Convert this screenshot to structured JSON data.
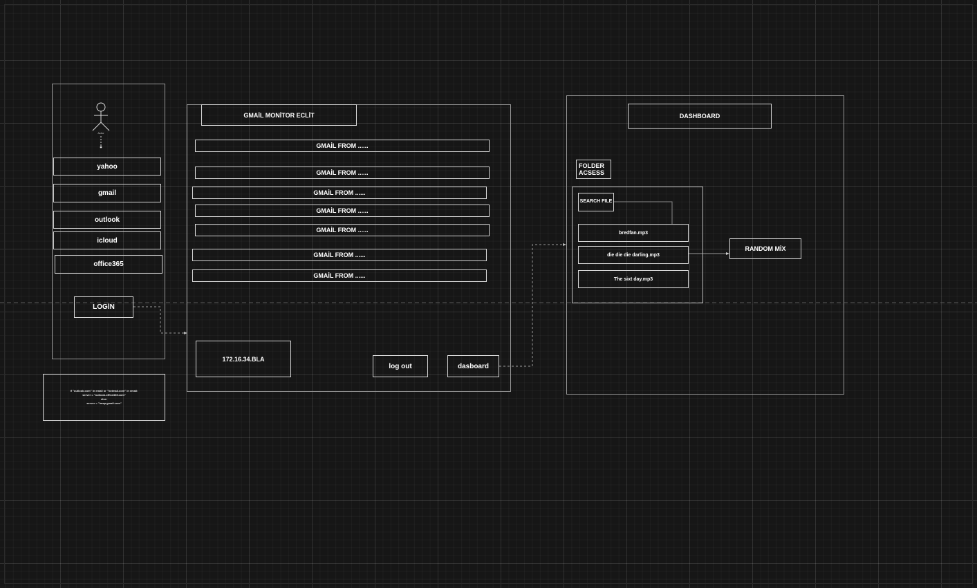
{
  "actor": {
    "caption": "Actor"
  },
  "login_panel": {
    "providers": [
      "yahoo",
      "gmail",
      "outlook",
      "icloud",
      "office365"
    ],
    "login_label": "LOGİN"
  },
  "code_note": {
    "lines": [
      "if \"outlook.com\" in email or \"hotmail.com\" in email:",
      "server = \"outlook.office365.com\"",
      "else:",
      "server = \"imap.gmail.com\""
    ]
  },
  "monitor_panel": {
    "title": "GMAİL MONİTOR ECLİT",
    "emails": [
      "GMAİL FROM ......",
      "GMAİL FROM ......",
      "GMAİL FROM ......",
      "GMAİL FROM ......",
      "GMAİL FROM ......",
      "GMAİL FROM ......",
      "GMAİL FROM ......"
    ],
    "ip_label": "172.16.34.BLA",
    "logout_label": "log out",
    "dashboard_label": "dasboard"
  },
  "dashboard_panel": {
    "title": "DASHBOARD",
    "folder_access_label": "FOLDER ACSESS",
    "search_file_label": "SEARCH FILE",
    "files": [
      "bredfan.mp3",
      "die die die darling.mp3",
      "The sixt day.mp3"
    ],
    "random_mix_label": "RANDOM MİX"
  },
  "colors": {
    "background": "#161616",
    "stroke": "#d8d8d8",
    "text": "#ffffff"
  }
}
